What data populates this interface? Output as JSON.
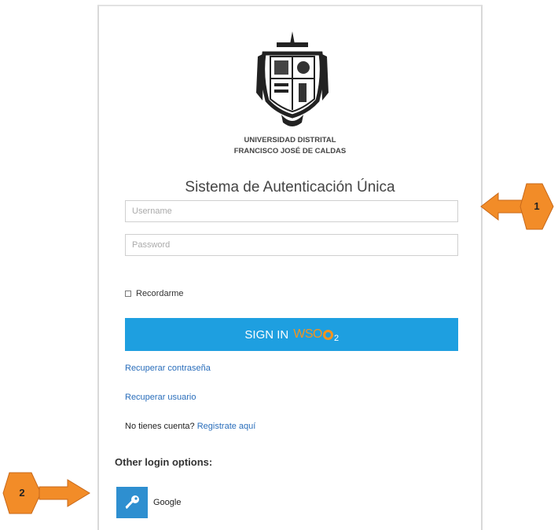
{
  "header": {
    "university_line1": "UNIVERSIDAD DISTRITAL",
    "university_line2": "FRANCISCO JOSÉ DE CALDAS",
    "system_title": "Sistema de Autenticación Única"
  },
  "form": {
    "username_placeholder": "Username",
    "password_placeholder": "Password",
    "remember_label": "Recordarme",
    "signin_label": "SIGN IN",
    "signin_brand": "WSO",
    "signin_brand_sub": "2"
  },
  "links": {
    "recover_password": "Recuperar contraseña",
    "recover_user": "Recuperar usuario",
    "no_account": "No tienes cuenta?",
    "register": "Registrate aquí"
  },
  "other_login": {
    "title": "Other login options:",
    "google_label": "Google"
  },
  "annotations": {
    "callout_1": "1",
    "callout_2": "2"
  },
  "colors": {
    "signin_bg": "#1e9fe0",
    "wso2_orange": "#f7941d",
    "link": "#2a6ebb",
    "google_tile": "#2e8fd0",
    "callout": "#f28c28"
  }
}
